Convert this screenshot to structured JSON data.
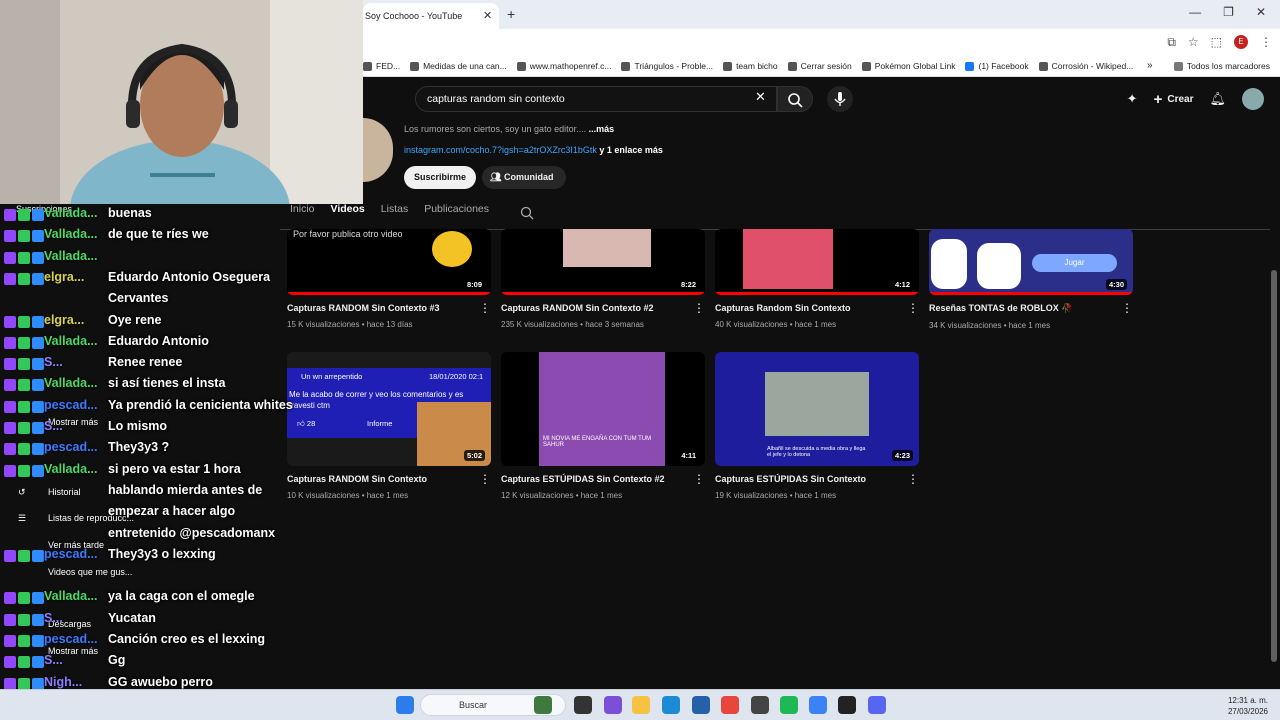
{
  "browser": {
    "tab_title": "Soy Cochooo - YouTube",
    "tab_close": "✕",
    "new_tab": "+",
    "window_controls": [
      "—",
      "❐",
      "✕"
    ],
    "profile_initial": "E",
    "bookmarks": [
      {
        "label": "FED...",
        "icon": "folder-icon"
      },
      {
        "label": "Medidas de una can...",
        "icon": "page-icon"
      },
      {
        "label": "www.mathopenref.c...",
        "icon": "globe-icon"
      },
      {
        "label": "Triángulos - Proble...",
        "icon": "page-icon"
      },
      {
        "label": "team bicho",
        "icon": "page-icon"
      },
      {
        "label": "Cerrar sesión",
        "icon": "globe-icon"
      },
      {
        "label": "Pokémon Global Link",
        "icon": "globe-icon"
      },
      {
        "label": "(1) Facebook",
        "icon": "facebook-icon"
      },
      {
        "label": "Corrosión - Wikiped...",
        "icon": "wikipedia-icon"
      }
    ],
    "bookmarks_more": "»",
    "all_bookmarks": "Todos los marcadores"
  },
  "youtube": {
    "search_value": "capturas random sin contexto",
    "create_label": "Crear",
    "channel": {
      "description": "Los rumores son ciertos, soy un gato editor....",
      "more_label": "...más",
      "link": "instagram.com/cocho.7?igsh=a2trOXZrc3I1bGtk",
      "link_more": "y 1 enlace más",
      "subscribe_label": "Suscribirme",
      "community_label": "Comunidad"
    },
    "tabs": [
      "Inicio",
      "Videos",
      "Listas",
      "Publicaciones"
    ],
    "videos_row1": [
      {
        "title": "Capturas RANDOM Sin Contexto #3",
        "views": "15 K visualizaciones",
        "age": "hace 13 días",
        "duration": "8:09",
        "thumb_text": "Por favor publica otro video",
        "watched": 1.0
      },
      {
        "title": "Capturas RANDOM Sin Contexto #2",
        "views": "235 K visualizaciones",
        "age": "hace 3 semanas",
        "duration": "8:22",
        "thumb_text": "",
        "watched": 1.0
      },
      {
        "title": "Capturas Random Sin Contexto",
        "views": "40 K visualizaciones",
        "age": "hace 1 mes",
        "duration": "4:12",
        "thumb_text": "",
        "watched": 1.0
      },
      {
        "title": "Reseñas TONTAS de ROBLOX 🥀",
        "views": "34 K visualizaciones",
        "age": "hace 1 mes",
        "duration": "4:30",
        "thumb_text": "Jugar",
        "watched": 1.0
      }
    ],
    "videos_row2": [
      {
        "title": "Capturas RANDOM Sin Contexto",
        "views": "10 K visualizaciones",
        "age": "hace 1 mes",
        "duration": "5:02",
        "thumb_header": "Un wn arrepentido",
        "thumb_date": "18/01/2020 02:1",
        "thumb_text": "Me la acabo de correr y veo los comentarios y es travesti ctm",
        "thumb_likes": "28",
        "thumb_report": "Informe"
      },
      {
        "title": "Capturas ESTÚPIDAS Sin Contexto #2",
        "views": "12 K visualizaciones",
        "age": "hace 1 mes",
        "duration": "4:11",
        "thumb_text": "MI NOVIA ME ENGAÑA CON TUM TUM SAHUR"
      },
      {
        "title": "Capturas ESTÚPIDAS Sin Contexto",
        "views": "19 K visualizaciones",
        "age": "hace 1 mes",
        "duration": "4:23",
        "thumb_text": "Albañil se descuida a media obra y llega el jefe y lo detona"
      }
    ]
  },
  "sidebar_ghost": [
    "Suscripciones",
    "Historial",
    "Listas de reproducc...",
    "Ver más tarde",
    "Videos que me gus...",
    "Descargas",
    "Mostrar más",
    "Mostrar más"
  ],
  "chat": [
    {
      "user": "Vallada...",
      "color": "#4cd964",
      "msg": "buenas"
    },
    {
      "user": "Vallada...",
      "color": "#4cd964",
      "msg": "de que te ríes we"
    },
    {
      "user": "Vallada...",
      "color": "#4cd964",
      "msg": ""
    },
    {
      "user": "elgra...",
      "color": "#d9d34c",
      "msg": "Eduardo Antonio Oseguera"
    },
    {
      "user": "",
      "color": "#ffffff",
      "msg": "Cervantes"
    },
    {
      "user": "elgra...",
      "color": "#d9d34c",
      "msg": "Oye rene"
    },
    {
      "user": "Vallada...",
      "color": "#4cd964",
      "msg": "Eduardo Antonio"
    },
    {
      "user": "S...",
      "color": "#8a7dff",
      "msg": "Renee renee"
    },
    {
      "user": "Vallada...",
      "color": "#4cd964",
      "msg": "si así tienes el insta"
    },
    {
      "user": "pescad...",
      "color": "#3a7bff",
      "msg": "Ya prendió la cenicienta whites"
    },
    {
      "user": "S...",
      "color": "#8a7dff",
      "msg": "Lo mismo"
    },
    {
      "user": "pescad...",
      "color": "#3a7bff",
      "msg": "They3y3 ?"
    },
    {
      "user": "Vallada...",
      "color": "#4cd964",
      "msg": "si pero va estar 1 hora"
    },
    {
      "user": "",
      "color": "#ffffff",
      "msg": "hablando mierda antes de"
    },
    {
      "user": "",
      "color": "#ffffff",
      "msg": "empezar a hacer algo"
    },
    {
      "user": "",
      "color": "#ffffff",
      "msg": "entretenido @pescadomanx"
    },
    {
      "user": "pescad...",
      "color": "#3a7bff",
      "msg": "They3y3 o lexxing"
    },
    {
      "user": "",
      "color": "#ffffff",
      "msg": ""
    },
    {
      "user": "Vallada...",
      "color": "#4cd964",
      "msg": "ya la caga con el omegle"
    },
    {
      "user": "S...",
      "color": "#8a7dff",
      "msg": "Yucatan"
    },
    {
      "user": "pescad...",
      "color": "#3a7bff",
      "msg": "Canción creo es el lexxing"
    },
    {
      "user": "S...",
      "color": "#8a7dff",
      "msg": "Gg"
    },
    {
      "user": "Nigh...",
      "color": "#8a7dff",
      "msg": "GG awuebo perro"
    }
  ],
  "taskbar": {
    "search_placeholder": "Buscar",
    "time": "12:31 a. m.",
    "date": "27/03/2026"
  }
}
